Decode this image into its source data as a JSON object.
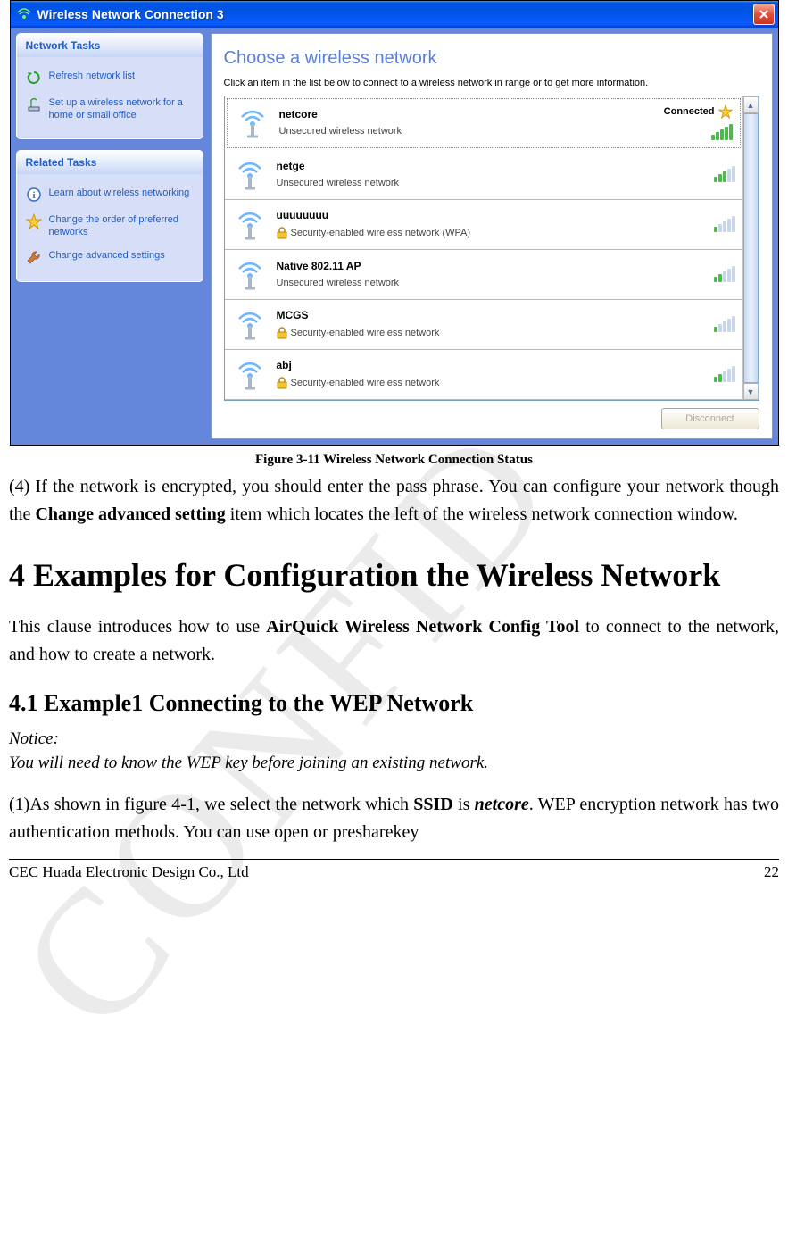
{
  "window": {
    "title": "Wireless Network Connection 3",
    "sidebar": {
      "panel1": {
        "title": "Network Tasks",
        "items": [
          {
            "label": "Refresh network list",
            "icon": "refresh-icon"
          },
          {
            "label": "Set up a wireless network for a home or small office",
            "icon": "antenna-icon"
          }
        ]
      },
      "panel2": {
        "title": "Related Tasks",
        "items": [
          {
            "label": "Learn about wireless networking",
            "icon": "info-icon"
          },
          {
            "label": "Change the order of preferred networks",
            "icon": "star-icon"
          },
          {
            "label": "Change advanced settings",
            "icon": "wrench-icon"
          }
        ]
      }
    },
    "content": {
      "heading": "Choose a wireless network",
      "sub_pre": "Click an item in the list below to connect to a ",
      "sub_ul": "w",
      "sub_post": "ireless network in range or to get more information.",
      "networks": [
        {
          "name": "netcore",
          "desc": "Unsecured wireless network",
          "secure": false,
          "signal": 5,
          "status": "Connected",
          "star": true
        },
        {
          "name": "netge",
          "desc": "Unsecured wireless network",
          "secure": false,
          "signal": 3,
          "status": "",
          "star": false
        },
        {
          "name": "uuuuuuuu",
          "desc": "Security-enabled wireless network (WPA)",
          "secure": true,
          "signal": 1,
          "status": "",
          "star": false
        },
        {
          "name": "Native 802.11 AP",
          "desc": "Unsecured wireless network",
          "secure": false,
          "signal": 2,
          "status": "",
          "star": false
        },
        {
          "name": "MCGS",
          "desc": "Security-enabled wireless network",
          "secure": true,
          "signal": 1,
          "status": "",
          "star": false
        },
        {
          "name": "abj",
          "desc": "Security-enabled wireless network",
          "secure": true,
          "signal": 2,
          "status": "",
          "star": false
        }
      ],
      "disconnect_label": "Disconnect"
    }
  },
  "doc": {
    "figure_caption": "Figure 3-11 Wireless Network Connection Status",
    "para4_a": "(4) If the network is encrypted, you should enter the pass phrase. You can configure your network though the ",
    "para4_bold": "Change advanced setting",
    "para4_b": " item which locates the left of the wireless network connection window.",
    "h1": "4 Examples for Configuration the Wireless Network",
    "intro_a": "This clause introduces how to use ",
    "intro_bold": "AirQuick Wireless Network Config Tool",
    "intro_b": " to connect to the network, and how to create a network.",
    "h2": "4.1 Example1 Connecting to the WEP Network",
    "notice_label": "Notice:",
    "notice_text": "You will need to know the WEP key before joining an existing network.",
    "para1_a": "(1)As shown in figure 4-1, we select the network which ",
    "para1_ssid": "SSID",
    "para1_b": " is ",
    "para1_netcore": "netcore",
    "para1_c": ". WEP encryption network has two authentication methods. You can use open or presharekey",
    "footer_left": "CEC Huada Electronic Design Co., Ltd",
    "footer_right": "22",
    "watermark": "CONFID"
  }
}
